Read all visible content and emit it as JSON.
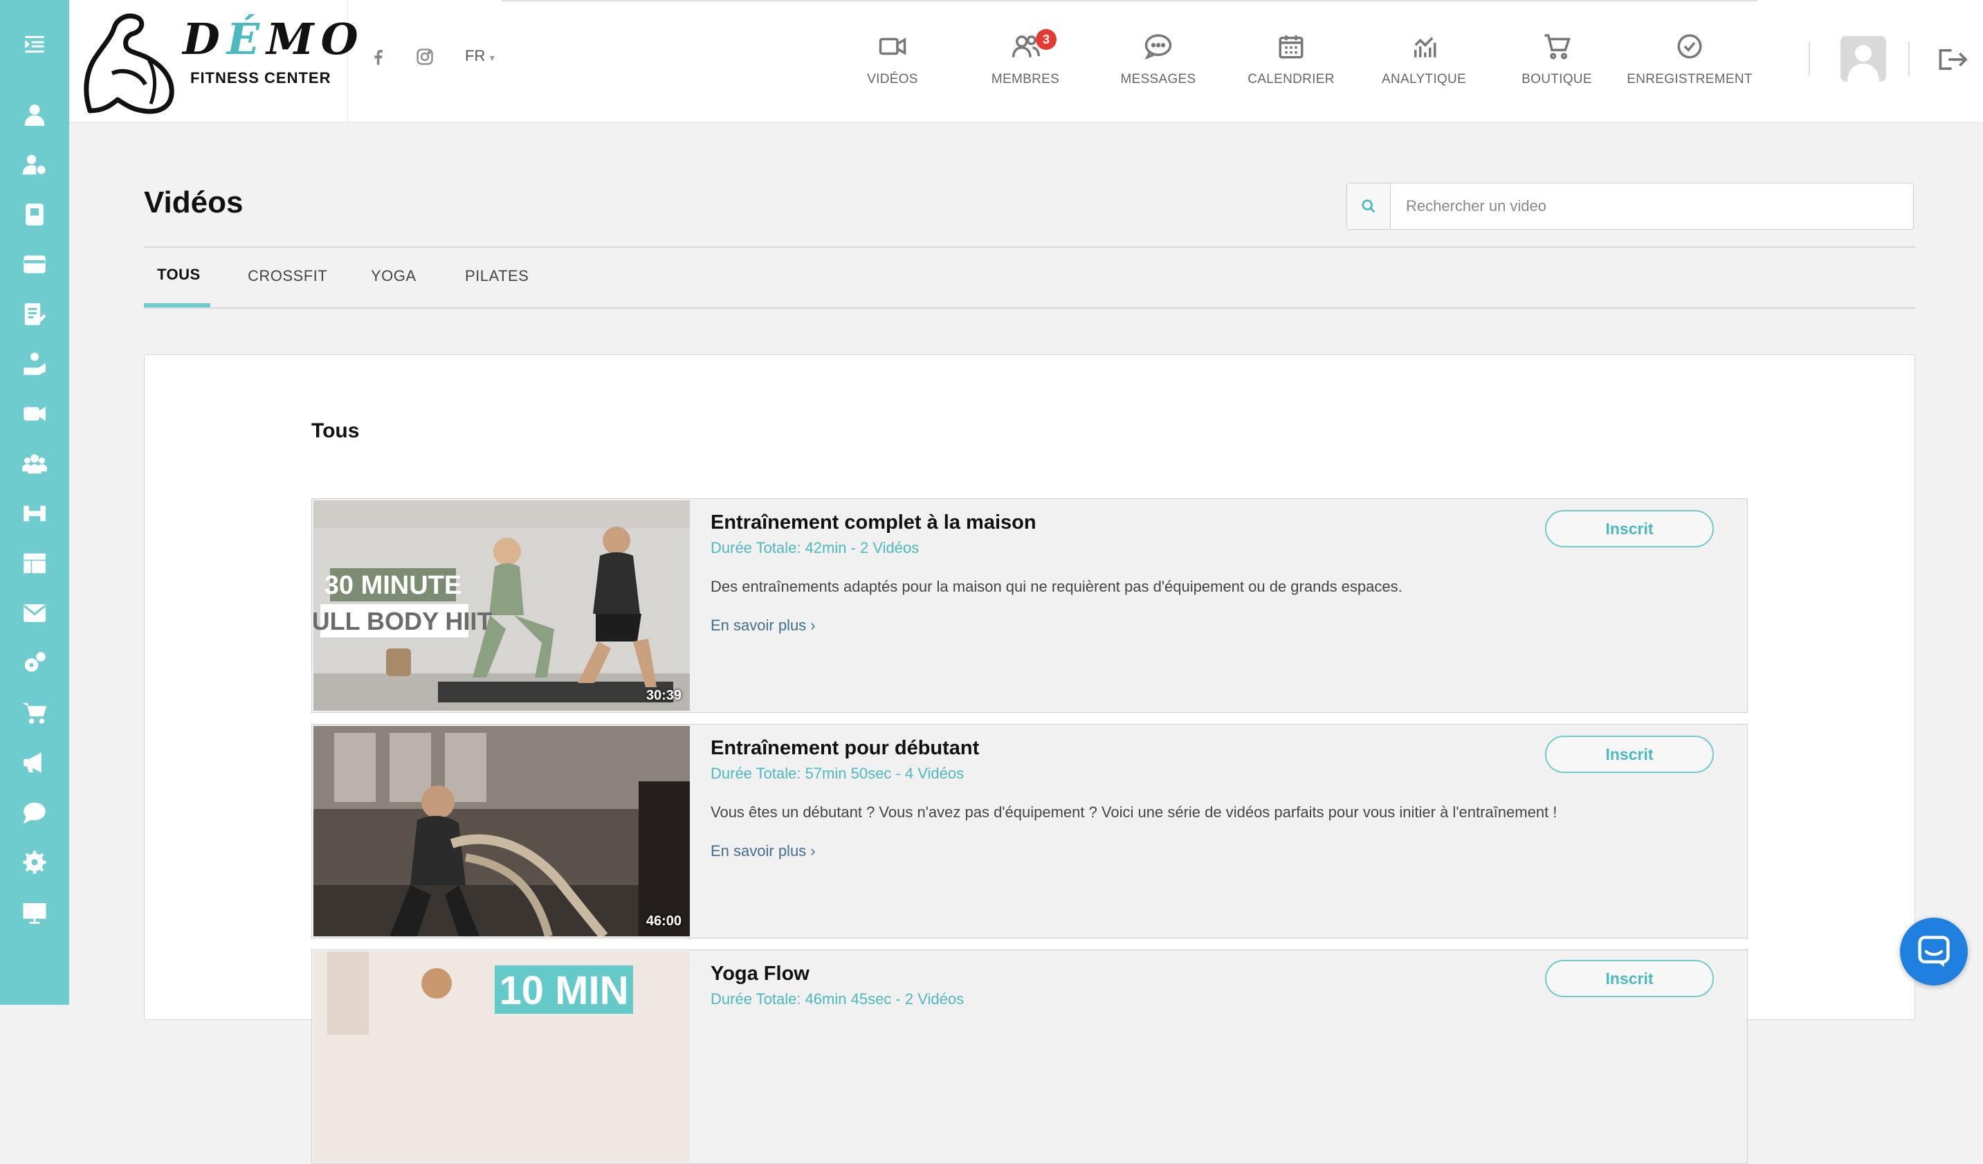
{
  "brand": {
    "logo_title_start": "D",
    "logo_title_accent": "É",
    "logo_title_end": "MO",
    "logo_subtitle": "FITNESS CENTER",
    "accent_color": "#6ecbce"
  },
  "header": {
    "language": "FR",
    "nav": [
      {
        "label": "VIDÉOS",
        "icon": "video-icon"
      },
      {
        "label": "MEMBRES",
        "icon": "members-icon",
        "badge": "3"
      },
      {
        "label": "MESSAGES",
        "icon": "messages-icon"
      },
      {
        "label": "CALENDRIER",
        "icon": "calendar-icon"
      },
      {
        "label": "ANALYTIQUE",
        "icon": "analytics-icon"
      },
      {
        "label": "BOUTIQUE",
        "icon": "cart-icon"
      },
      {
        "label": "ENREGISTREMENT",
        "icon": "check-circle-icon"
      }
    ]
  },
  "sidebar": {
    "icons": [
      "menu-expand-icon",
      "user-icon",
      "user-settings-icon",
      "book-icon",
      "credit-card-icon",
      "edit-doc-icon",
      "hand-icon",
      "video-icon",
      "group-icon",
      "dumbbell-icon",
      "layout-icon",
      "mail-icon",
      "cogs-icon",
      "cart-icon",
      "megaphone-icon",
      "chat-icon",
      "gear-icon",
      "monitor-icon"
    ]
  },
  "page": {
    "title": "Vidéos",
    "search_placeholder": "Rechercher un video",
    "tabs": [
      "TOUS",
      "CROSSFIT",
      "YOGA",
      "PILATES"
    ],
    "active_tab": "TOUS",
    "section_title": "Tous"
  },
  "videos": [
    {
      "title": "Entraînement complet à la maison",
      "meta": "Durée Totale: 42min - 2 Vidéos",
      "description": "Des entraînements adaptés pour la maison qui ne requièrent pas d'équipement ou de grands espaces.",
      "more": "En savoir plus ›",
      "button": "Inscrit",
      "duration": "30:39",
      "thumb_line1": "30 MINUTE",
      "thumb_line2": "FULL BODY HIIT"
    },
    {
      "title": "Entraînement pour débutant",
      "meta": "Durée Totale: 57min 50sec - 4 Vidéos",
      "description": "Vous êtes un débutant ? Vous n'avez pas d'équipement ? Voici une série de vidéos parfaits pour vous initier à l'entraînement !",
      "more": "En savoir plus ›",
      "button": "Inscrit",
      "duration": "46:00"
    },
    {
      "title": "Yoga Flow",
      "meta": "Durée Totale: 46min 45sec - 2 Vidéos",
      "button": "Inscrit",
      "thumb_line1": "10 MIN"
    }
  ]
}
